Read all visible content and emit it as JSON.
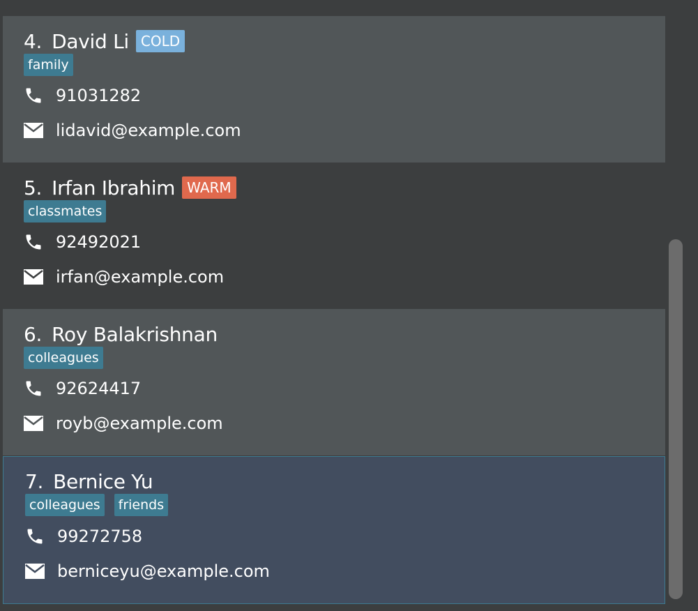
{
  "colors": {
    "card_odd": "#515658",
    "card_even": "#3c3e3f",
    "card_selected": "#424d5f",
    "tag": "#3e7b91",
    "status_cold": "#7ab1dc",
    "status_warm": "#e0694d"
  },
  "contacts": [
    {
      "index": "4.",
      "name": "David Li",
      "status": "COLD",
      "tags": [
        "family"
      ],
      "phone": "91031282",
      "email": "lidavid@example.com"
    },
    {
      "index": "5.",
      "name": "Irfan Ibrahim",
      "status": "WARM",
      "tags": [
        "classmates"
      ],
      "phone": "92492021",
      "email": "irfan@example.com"
    },
    {
      "index": "6.",
      "name": "Roy Balakrishnan",
      "status": "",
      "tags": [
        "colleagues"
      ],
      "phone": "92624417",
      "email": "royb@example.com"
    },
    {
      "index": "7.",
      "name": "Bernice Yu",
      "status": "",
      "tags": [
        "colleagues",
        "friends"
      ],
      "phone": "99272758",
      "email": "berniceyu@example.com"
    }
  ],
  "icons": {
    "phone": "phone-icon",
    "email": "email-icon"
  }
}
